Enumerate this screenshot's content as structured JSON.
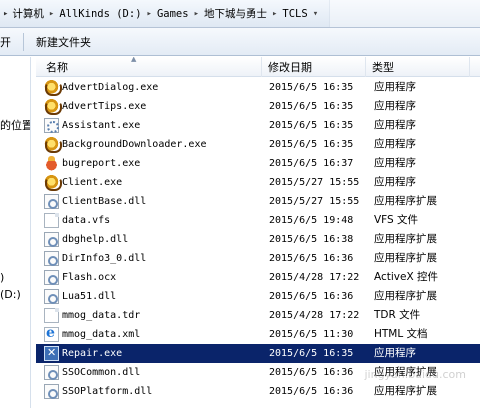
{
  "breadcrumb": {
    "items": [
      "计算机",
      "AllKinds (D:)",
      "Games",
      "地下城与勇士",
      "TCLS"
    ]
  },
  "toolbar": {
    "open_label": "开",
    "new_folder_label": "新建文件夹"
  },
  "nav": {
    "recent_places_label": "的位置",
    "paren_label": ")",
    "drive_label": "(D:)"
  },
  "columns": {
    "name": "名称",
    "date": "修改日期",
    "type": "类型"
  },
  "files": [
    {
      "name": "AdvertDialog.exe",
      "date": "2015/6/5 16:35",
      "type": "应用程序",
      "icon": "app-icon"
    },
    {
      "name": "AdvertTips.exe",
      "date": "2015/6/5 16:35",
      "type": "应用程序",
      "icon": "app-icon"
    },
    {
      "name": "Assistant.exe",
      "date": "2015/6/5 16:35",
      "type": "应用程序",
      "icon": "gear-file-icon"
    },
    {
      "name": "BackgroundDownloader.exe",
      "date": "2015/6/5 16:35",
      "type": "应用程序",
      "icon": "app-icon"
    },
    {
      "name": "bugreport.exe",
      "date": "2015/6/5 16:37",
      "type": "应用程序",
      "icon": "bug-icon"
    },
    {
      "name": "Client.exe",
      "date": "2015/5/27 15:55",
      "type": "应用程序",
      "icon": "app-icon"
    },
    {
      "name": "ClientBase.dll",
      "date": "2015/5/27 15:55",
      "type": "应用程序扩展",
      "icon": "dll-icon"
    },
    {
      "name": "data.vfs",
      "date": "2015/6/5 19:48",
      "type": "VFS 文件",
      "icon": "file-icon"
    },
    {
      "name": "dbghelp.dll",
      "date": "2015/6/5 16:38",
      "type": "应用程序扩展",
      "icon": "dll-icon"
    },
    {
      "name": "DirInfo3_0.dll",
      "date": "2015/6/5 16:36",
      "type": "应用程序扩展",
      "icon": "dll-icon"
    },
    {
      "name": "Flash.ocx",
      "date": "2015/4/28 17:22",
      "type": "ActiveX 控件",
      "icon": "dll-icon"
    },
    {
      "name": "Lua51.dll",
      "date": "2015/6/5 16:36",
      "type": "应用程序扩展",
      "icon": "dll-icon"
    },
    {
      "name": "mmog_data.tdr",
      "date": "2015/4/28 17:22",
      "type": "TDR 文件",
      "icon": "file-icon"
    },
    {
      "name": "mmog_data.xml",
      "date": "2015/6/5 11:30",
      "type": "HTML 文档",
      "icon": "web-icon"
    },
    {
      "name": "Repair.exe",
      "date": "2015/6/5 16:35",
      "type": "应用程序",
      "icon": "repair-icon",
      "selected": true
    },
    {
      "name": "SSOCommon.dll",
      "date": "2015/6/5 16:36",
      "type": "应用程序扩展",
      "icon": "dll-icon"
    },
    {
      "name": "SSOPlatform.dll",
      "date": "2015/6/5 16:36",
      "type": "应用程序扩展",
      "icon": "dll-icon"
    }
  ],
  "watermark": "jingyan.baidu.com"
}
